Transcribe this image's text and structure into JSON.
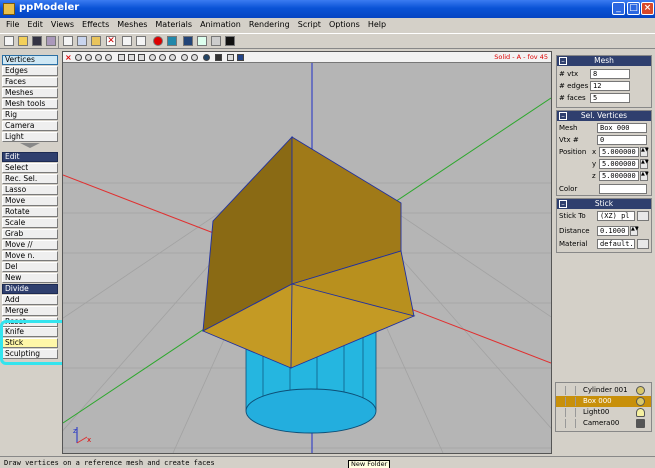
{
  "window": {
    "title": "ppModeler",
    "min_glyph": "_",
    "max_glyph": "□",
    "close_glyph": "×"
  },
  "menu": [
    "File",
    "Edit",
    "Views",
    "Effects",
    "Meshes",
    "Materials",
    "Animation",
    "Rendering",
    "Script",
    "Options",
    "Help"
  ],
  "left_panel": {
    "modes": [
      "Vertices",
      "Edges",
      "Faces",
      "Meshes",
      "Mesh tools",
      "Rig",
      "Camera",
      "Light"
    ],
    "tools": [
      "Edit",
      "Select",
      "Rec. Sel.",
      "Lasso",
      "Move",
      "Rotate",
      "Scale",
      "Grab",
      "Move //",
      "Move n.",
      "Del",
      "New",
      "Divide",
      "Add",
      "Merge",
      "Reset",
      "Knife",
      "Stick",
      "Sculpting"
    ]
  },
  "viewport": {
    "close_glyph": "×",
    "info": "Solid - A - fov 45",
    "colors": {
      "background": "#b5b5b5",
      "box_face": "#b8901e",
      "cylinder": "#25b6e0",
      "axis_x": "#e03030",
      "axis_y": "#2ea82e",
      "axis_z": "#2030c8"
    },
    "axis_gizmo": {
      "x": "x",
      "z": "z"
    }
  },
  "mesh_panel": {
    "title": "Mesh",
    "rows": [
      {
        "label": "# vtx",
        "value": "8"
      },
      {
        "label": "# edges",
        "value": "12"
      },
      {
        "label": "# faces",
        "value": "5"
      }
    ]
  },
  "sel_vertices_panel": {
    "title": "Sel. Vertices",
    "mesh_label": "Mesh",
    "mesh_value": "Box 000",
    "vtx_label": "Vtx #",
    "vtx_value": "0",
    "position_label": "Position",
    "x_label": "x",
    "x_value": "5.000000",
    "y_label": "y",
    "y_value": "5.000000",
    "z_label": "z",
    "z_value": "5.000000",
    "color_label": "Color"
  },
  "stick_panel": {
    "title": "Stick",
    "stick_to_label": "Stick To",
    "stick_to_value": "(XZ) pl",
    "distance_label": "Distance",
    "distance_value": "0.1000",
    "material_label": "Material",
    "material_value": "default."
  },
  "outliner": {
    "items": [
      {
        "name": "Cylinder 001",
        "icon": "sphere-icon"
      },
      {
        "name": "Box 000",
        "icon": "sphere-icon"
      },
      {
        "name": "Light00",
        "icon": "bulb-icon"
      },
      {
        "name": "Camera00",
        "icon": "camera-icon"
      }
    ],
    "selected_index": 1
  },
  "status": "Draw vertices on a reference mesh and create faces",
  "tooltip": "New Folder"
}
